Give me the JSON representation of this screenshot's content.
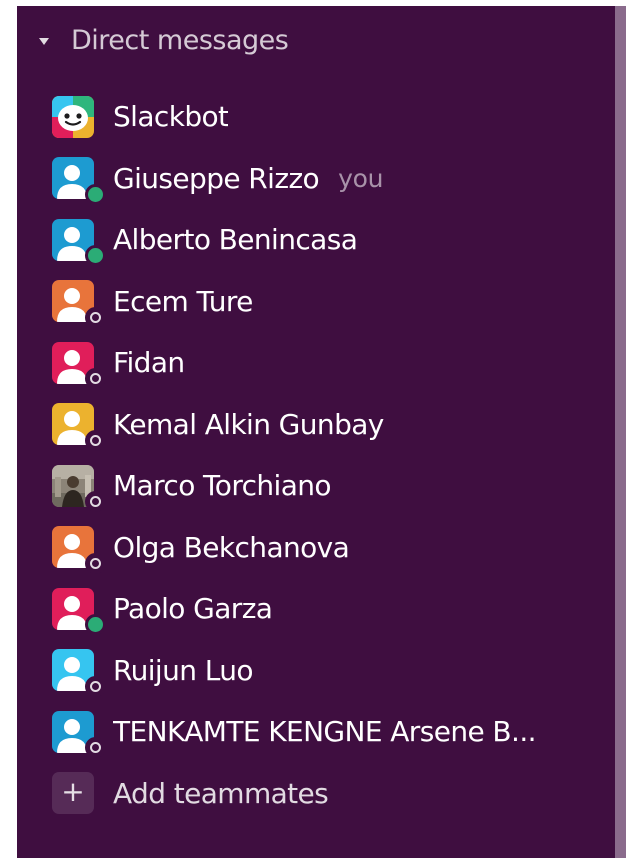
{
  "section": {
    "title": "Direct messages"
  },
  "colors": {
    "sidebar_bg": "#3f0e40",
    "presence_active": "#2bac76"
  },
  "dms": [
    {
      "name": "Slackbot",
      "avatar": "slackbot",
      "presence": "none",
      "you": ""
    },
    {
      "name": "Giuseppe Rizzo",
      "avatar": "blue",
      "presence": "active",
      "you": "you"
    },
    {
      "name": "Alberto Benincasa",
      "avatar": "blue",
      "presence": "active",
      "you": ""
    },
    {
      "name": "Ecem Ture",
      "avatar": "orange",
      "presence": "away",
      "you": ""
    },
    {
      "name": "Fidan",
      "avatar": "pink",
      "presence": "away",
      "you": ""
    },
    {
      "name": "Kemal Alkin Gunbay",
      "avatar": "yellow",
      "presence": "away",
      "you": ""
    },
    {
      "name": "Marco Torchiano",
      "avatar": "photo",
      "presence": "away",
      "you": ""
    },
    {
      "name": "Olga Bekchanova",
      "avatar": "orange",
      "presence": "away",
      "you": ""
    },
    {
      "name": "Paolo Garza",
      "avatar": "pink",
      "presence": "active",
      "you": ""
    },
    {
      "name": "Ruijun Luo",
      "avatar": "lightblue",
      "presence": "away",
      "you": ""
    },
    {
      "name": "TENKAMTE KENGNE Arsene B...",
      "avatar": "blue",
      "presence": "away",
      "you": ""
    }
  ],
  "add_teammates": {
    "label": "Add teammates",
    "icon": "plus-icon"
  }
}
